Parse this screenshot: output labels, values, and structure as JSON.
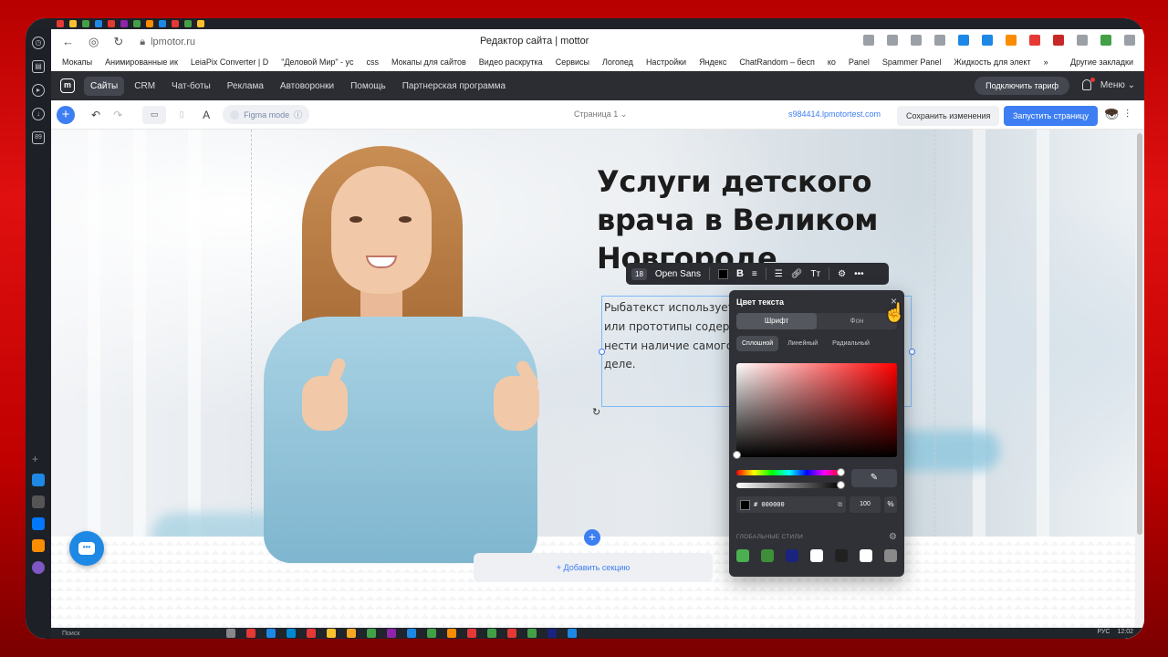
{
  "browser": {
    "url": "lpmotor.ru",
    "title": "Редактор сайта | mottor"
  },
  "bookmarks": {
    "items": [
      "Мокапы",
      "Анимированные ик",
      "LeiaPix Converter | D",
      "\"Деловой Мир\" - ус",
      "css",
      "Мокапы для сайтов",
      "Видео раскрутка",
      "Сервисы",
      "Логопед",
      "Настройки",
      "Яндекс",
      "ChatRandom – бесп",
      "ко",
      "Panel",
      "Spammer Panel",
      "Жидкость для элект",
      "»"
    ],
    "other": "Другие закладки"
  },
  "appbar": {
    "logo": "m",
    "menu": [
      "Сайты",
      "CRM",
      "Чат-боты",
      "Реклама",
      "Автоворонки",
      "Помощь",
      "Партнерская программа"
    ],
    "tariff": "Подключить тариф",
    "menu_label": "Меню ⌄"
  },
  "toolbar": {
    "add": "+",
    "figma": "Figma mode",
    "page": "Страница 1 ⌄",
    "domain": "s984414.lpmotortest.com",
    "save": "Сохранить изменения",
    "launch": "Запустить страницу"
  },
  "hero": {
    "heading": "Услуги детского врача в Великом Новгороде",
    "paragraph": "Рыбатекст используется и фронтендерами, когда или прототипы содержим который не должен нести наличие самого текста и. типографику в деле."
  },
  "format_bar": {
    "size": "18",
    "font": "Open Sans",
    "bold": "B"
  },
  "color_popup": {
    "title": "Цвет текста",
    "tabs": [
      "Шрифт",
      "Фон"
    ],
    "modes": [
      "Сплошной",
      "Линейный",
      "Радиальный"
    ],
    "hex": "# 000000",
    "opacity": "100",
    "percent": "%",
    "global_styles": "ГЛОБАЛЬНЫЕ СТИЛИ",
    "swatches": [
      "#4caf50",
      "#3f8f3a",
      "#1a237e",
      "#ffffff",
      "#212121",
      "#ffffff",
      "#8a8a8a"
    ]
  },
  "canvas": {
    "add_section": "+ Добавить секцию"
  },
  "taskbar": {
    "search": "Поиск",
    "lang": "РУС",
    "time": "12:02"
  }
}
